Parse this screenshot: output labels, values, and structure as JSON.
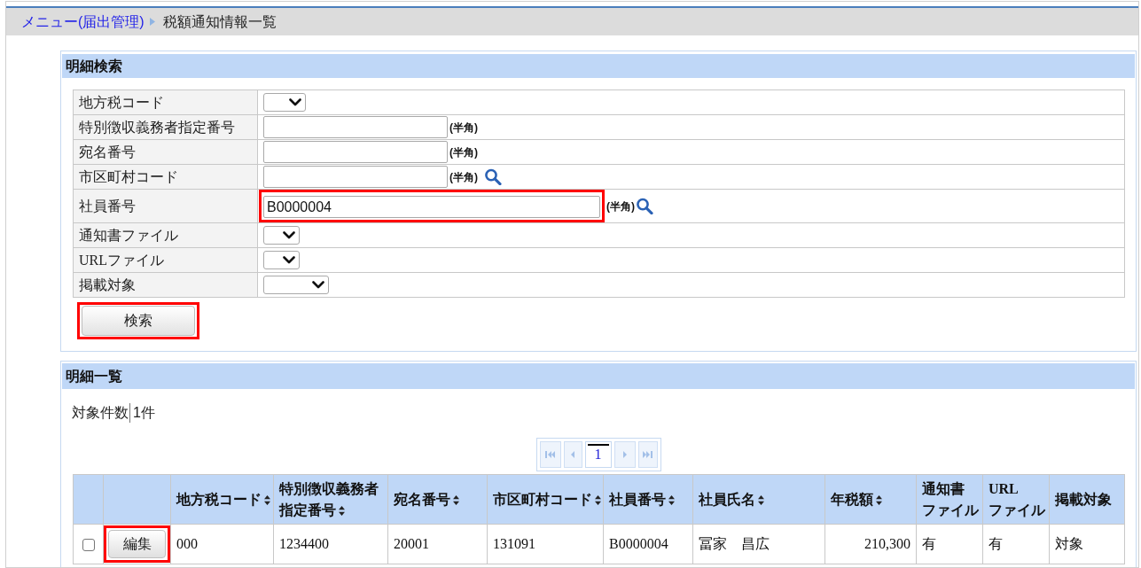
{
  "breadcrumb": [
    {
      "label": "メニュー(届出管理)",
      "kind": "link"
    },
    {
      "label": "税額通知情報一覧",
      "kind": "current"
    }
  ],
  "search_panel": {
    "title": "明細検索",
    "fields": [
      {
        "label": "地方税コード",
        "kind": "select",
        "lookup": false,
        "highlighted": false
      },
      {
        "label": "特別徴収義務者指定番号",
        "kind": "text",
        "note": "(半角)",
        "lookup": false,
        "highlighted": false
      },
      {
        "label": "宛名番号",
        "kind": "text",
        "note": "(半角)",
        "lookup": false,
        "highlighted": false
      },
      {
        "label": "市区町村コード",
        "kind": "text",
        "note": "(半角)",
        "lookup": true,
        "highlighted": false
      },
      {
        "label": "社員番号",
        "kind": "text",
        "value": "B0000004",
        "note": "(半角)",
        "lookup": true,
        "highlighted": true
      },
      {
        "label": "通知書ファイル",
        "kind": "select",
        "lookup": false,
        "highlighted": false
      },
      {
        "label": "URLファイル",
        "kind": "select",
        "lookup": false,
        "highlighted": false
      },
      {
        "label": "掲載対象",
        "kind": "select",
        "lookup": false,
        "highlighted": false
      }
    ],
    "search_button": {
      "label": "検索",
      "highlighted": true
    }
  },
  "results_panel": {
    "title": "明細一覧",
    "count_label": "対象件数",
    "count": "1件",
    "pagination": {
      "nav_before": [
        {
          "kind": "first",
          "disabled": true
        },
        {
          "kind": "prev",
          "disabled": true
        }
      ],
      "pages": [
        {
          "label": "1",
          "selected": true
        }
      ],
      "nav_after": [
        {
          "kind": "next",
          "disabled": true
        },
        {
          "kind": "last",
          "disabled": true
        }
      ]
    },
    "table": {
      "columns": [
        {
          "label": "地方税コード",
          "sortable": true
        },
        {
          "label": "特別徴収義務者指定番号",
          "sortable": true
        },
        {
          "label": "宛名番号",
          "sortable": true
        },
        {
          "label": "市区町村コード",
          "sortable": true
        },
        {
          "label": "社員番号",
          "sortable": true
        },
        {
          "label": "社員氏名",
          "sortable": true
        },
        {
          "label": "年税額",
          "sortable": true
        },
        {
          "label": "通知書ファイル",
          "sortable": false
        },
        {
          "label": "URLファイル",
          "sortable": false
        },
        {
          "label": "掲載対象",
          "sortable": false
        }
      ],
      "rows": [
        {
          "checked": false,
          "action": {
            "label": "編集",
            "highlighted": true
          },
          "cells": [
            "000",
            "1234400",
            "20001",
            "131091",
            "B0000004",
            "冨家　昌広",
            "210,300",
            "有",
            "有",
            "対象"
          ]
        }
      ]
    }
  }
}
